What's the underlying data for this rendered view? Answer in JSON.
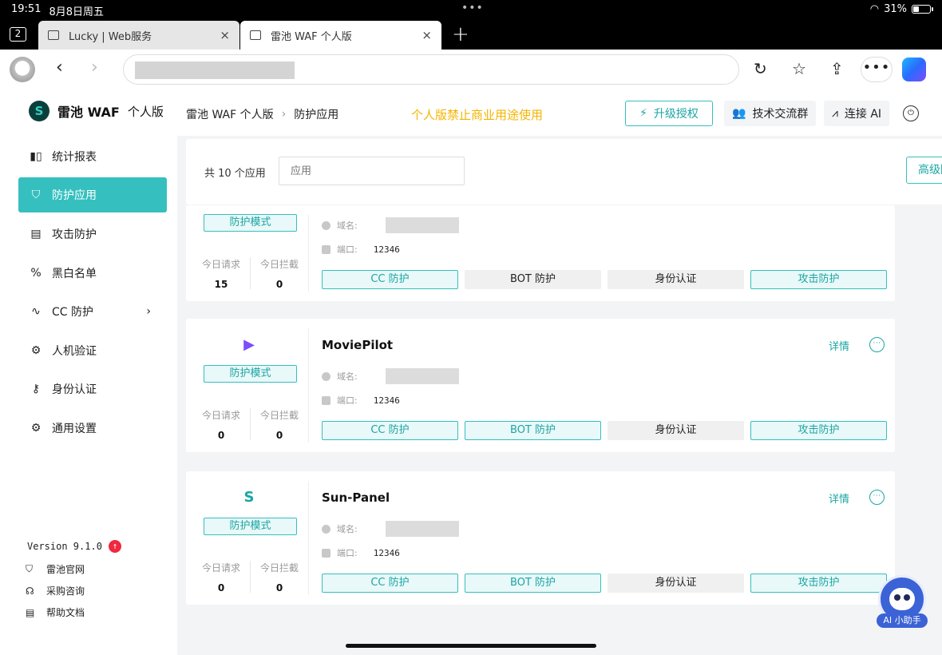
{
  "statusbar": {
    "time": "19:51",
    "date": "8月8日周五",
    "battery": "31%",
    "battery_level": 0.31
  },
  "browser": {
    "tab_count": "2",
    "tabs": [
      {
        "title": "Lucky | Web服务",
        "active": false
      },
      {
        "title": "雷池 WAF 个人版",
        "active": true
      }
    ]
  },
  "icons": {
    "close": "×",
    "new_tab": "+",
    "back": "‹",
    "forward": "›",
    "reload": "↻",
    "favorites": "☆",
    "share": "⇪",
    "more": "•••",
    "shield": "◇",
    "chevron": "›",
    "check": "✓",
    "upgrade": "⚡",
    "group": "👥",
    "ai": "⩘",
    "logout": "⏻"
  },
  "brand": {
    "name": "雷池 WAF",
    "suffix": "个人版"
  },
  "sidebar": {
    "items": [
      {
        "label": "统计报表",
        "icon": "▮▯"
      },
      {
        "label": "防护应用",
        "icon": "⛉"
      },
      {
        "label": "攻击防护",
        "icon": "▤"
      },
      {
        "label": "黑白名单",
        "icon": "%"
      },
      {
        "label": "CC 防护",
        "icon": "∿"
      },
      {
        "label": "人机验证",
        "icon": "⚙"
      },
      {
        "label": "身份认证",
        "icon": "⚷"
      },
      {
        "label": "通用设置",
        "icon": "⚙"
      }
    ],
    "version": "Version 9.1.0",
    "version_badge": "↑",
    "links": [
      {
        "label": "雷池官网",
        "icon": "⛉"
      },
      {
        "label": "采购咨询",
        "icon": "☊"
      },
      {
        "label": "帮助文档",
        "icon": "▤"
      }
    ]
  },
  "topbar": {
    "breadcrumb": [
      "雷池 WAF 个人版",
      "防护应用"
    ],
    "breadcrumb_sep": "›",
    "notice": "个人版禁止商业用途使用",
    "upgrade_label": "升级授权",
    "group_label": "技术交流群",
    "ai_label": "连接 AI"
  },
  "filter": {
    "count_label": "共 10 个应用",
    "search_placeholder": "应用",
    "advanced_label": "高级防护"
  },
  "labels": {
    "mode": "防护模式",
    "req_today": "今日请求",
    "block_today": "今日拦截",
    "domain": "域名:",
    "port": "端口:",
    "detail": "详情",
    "cc": "CC 防护",
    "bot": "BOT 防护",
    "auth": "身份认证",
    "attack": "攻击防护"
  },
  "apps": [
    {
      "name": "",
      "port": "12346",
      "req": "15",
      "block": "0",
      "cc": true,
      "bot": false,
      "auth": false,
      "attack": true
    },
    {
      "name": "MoviePilot",
      "port": "12346",
      "req": "0",
      "block": "0",
      "cc": true,
      "bot": true,
      "auth": false,
      "attack": true,
      "logo": "▶",
      "logo_color": "#7b4dff"
    },
    {
      "name": "Sun-Panel",
      "port": "12346",
      "req": "0",
      "block": "0",
      "cc": true,
      "bot": true,
      "auth": false,
      "attack": true,
      "logo": "S",
      "logo_color": "#1aa6a4"
    }
  ],
  "ai_assistant": {
    "label": "AI 小助手"
  },
  "colors": {
    "accent": "#35c0bf",
    "notice": "#f5b400",
    "badge": "#f0293e"
  }
}
